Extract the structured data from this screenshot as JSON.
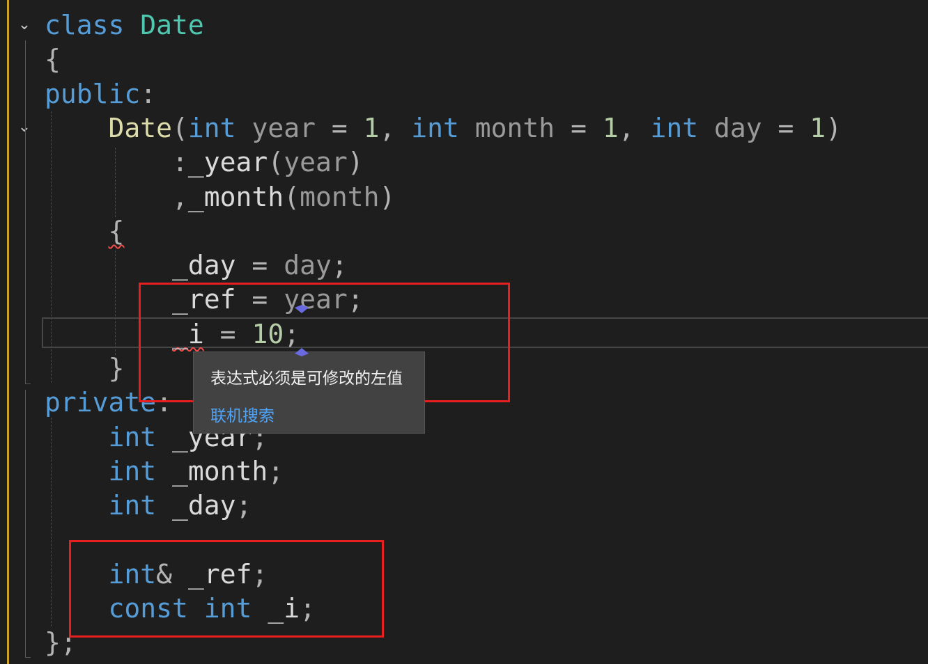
{
  "editor": {
    "lines": [
      {
        "id": "class-decl",
        "tokens": [
          {
            "t": "class",
            "c": "kw"
          },
          {
            "t": " ",
            "c": ""
          },
          {
            "t": "Date",
            "c": "type"
          }
        ]
      },
      {
        "id": "open-brace",
        "tokens": [
          {
            "t": "{",
            "c": "punc"
          }
        ]
      },
      {
        "id": "public-label",
        "tokens": [
          {
            "t": "public",
            "c": "kw"
          },
          {
            "t": ":",
            "c": "punc"
          }
        ]
      },
      {
        "id": "ctor-signature",
        "tokens": [
          {
            "t": "    ",
            "c": ""
          },
          {
            "t": "Date",
            "c": "fn"
          },
          {
            "t": "(",
            "c": "punc"
          },
          {
            "t": "int",
            "c": "kw"
          },
          {
            "t": " ",
            "c": ""
          },
          {
            "t": "year",
            "c": "param"
          },
          {
            "t": " = ",
            "c": "punc"
          },
          {
            "t": "1",
            "c": "num"
          },
          {
            "t": ", ",
            "c": "punc"
          },
          {
            "t": "int",
            "c": "kw"
          },
          {
            "t": " ",
            "c": ""
          },
          {
            "t": "month",
            "c": "param"
          },
          {
            "t": " = ",
            "c": "punc"
          },
          {
            "t": "1",
            "c": "num"
          },
          {
            "t": ", ",
            "c": "punc"
          },
          {
            "t": "int",
            "c": "kw"
          },
          {
            "t": " ",
            "c": ""
          },
          {
            "t": "day",
            "c": "param"
          },
          {
            "t": " = ",
            "c": "punc"
          },
          {
            "t": "1",
            "c": "num"
          },
          {
            "t": ")",
            "c": "punc"
          }
        ]
      },
      {
        "id": "init-year",
        "tokens": [
          {
            "t": "        ",
            "c": ""
          },
          {
            "t": ":",
            "c": "punc"
          },
          {
            "t": "_year",
            "c": "member"
          },
          {
            "t": "(",
            "c": "punc"
          },
          {
            "t": "year",
            "c": "param"
          },
          {
            "t": ")",
            "c": "punc"
          }
        ]
      },
      {
        "id": "init-month",
        "tokens": [
          {
            "t": "        ",
            "c": ""
          },
          {
            "t": ",",
            "c": "punc"
          },
          {
            "t": "_month",
            "c": "member"
          },
          {
            "t": "(",
            "c": "punc"
          },
          {
            "t": "month",
            "c": "param"
          },
          {
            "t": ")",
            "c": "punc"
          }
        ]
      },
      {
        "id": "ctor-open-brace",
        "tokens": [
          {
            "t": "    ",
            "c": ""
          },
          {
            "t": "{",
            "c": "punc squiggle"
          }
        ]
      },
      {
        "id": "assign-day",
        "tokens": [
          {
            "t": "        ",
            "c": ""
          },
          {
            "t": "_day",
            "c": "member"
          },
          {
            "t": " = ",
            "c": "punc"
          },
          {
            "t": "day",
            "c": "param"
          },
          {
            "t": ";",
            "c": "punc"
          }
        ]
      },
      {
        "id": "assign-ref",
        "tokens": [
          {
            "t": "        ",
            "c": ""
          },
          {
            "t": "_ref",
            "c": "member"
          },
          {
            "t": " = ",
            "c": "punc"
          },
          {
            "t": "year",
            "c": "param"
          },
          {
            "t": ";",
            "c": "punc"
          }
        ]
      },
      {
        "id": "assign-i",
        "tokens": [
          {
            "t": "        ",
            "c": ""
          },
          {
            "t": "_i",
            "c": "member squiggle"
          },
          {
            "t": " = ",
            "c": "punc"
          },
          {
            "t": "10",
            "c": "num"
          },
          {
            "t": ";",
            "c": "punc"
          }
        ]
      },
      {
        "id": "ctor-close-brace",
        "tokens": [
          {
            "t": "    ",
            "c": ""
          },
          {
            "t": "}",
            "c": "punc"
          }
        ]
      },
      {
        "id": "private-label",
        "tokens": [
          {
            "t": "private",
            "c": "kw"
          },
          {
            "t": ":",
            "c": "punc"
          }
        ]
      },
      {
        "id": "member-year",
        "tokens": [
          {
            "t": "    ",
            "c": ""
          },
          {
            "t": "int",
            "c": "kw"
          },
          {
            "t": " ",
            "c": ""
          },
          {
            "t": "_year",
            "c": "member"
          },
          {
            "t": ";",
            "c": "punc"
          }
        ]
      },
      {
        "id": "member-month",
        "tokens": [
          {
            "t": "    ",
            "c": ""
          },
          {
            "t": "int",
            "c": "kw"
          },
          {
            "t": " ",
            "c": ""
          },
          {
            "t": "_month",
            "c": "member"
          },
          {
            "t": ";",
            "c": "punc"
          }
        ]
      },
      {
        "id": "member-day",
        "tokens": [
          {
            "t": "    ",
            "c": ""
          },
          {
            "t": "int",
            "c": "kw"
          },
          {
            "t": " ",
            "c": ""
          },
          {
            "t": "_day",
            "c": "member"
          },
          {
            "t": ";",
            "c": "punc"
          }
        ]
      },
      {
        "id": "blank",
        "tokens": []
      },
      {
        "id": "member-ref",
        "tokens": [
          {
            "t": "    ",
            "c": ""
          },
          {
            "t": "int",
            "c": "kw"
          },
          {
            "t": "&",
            "c": "punc"
          },
          {
            "t": " ",
            "c": ""
          },
          {
            "t": "_ref",
            "c": "member"
          },
          {
            "t": ";",
            "c": "punc"
          }
        ]
      },
      {
        "id": "member-i",
        "tokens": [
          {
            "t": "    ",
            "c": ""
          },
          {
            "t": "const",
            "c": "kw"
          },
          {
            "t": " ",
            "c": ""
          },
          {
            "t": "int",
            "c": "kw"
          },
          {
            "t": " ",
            "c": ""
          },
          {
            "t": "_i",
            "c": "member"
          },
          {
            "t": ";",
            "c": "punc"
          }
        ]
      },
      {
        "id": "class-close",
        "tokens": [
          {
            "t": "}",
            "c": "punc"
          },
          {
            "t": ";",
            "c": "punc"
          }
        ]
      }
    ]
  },
  "tooltip": {
    "message": "表达式必须是可修改的左值",
    "link_label": "联机搜索"
  },
  "colors": {
    "background": "#1e1e1e",
    "keyword": "#569cd6",
    "type": "#4ec9b0",
    "function": "#dcdcaa",
    "number": "#b5cea8",
    "error_squiggle": "#f14c4c",
    "highlight_box": "#e81f1f",
    "link": "#4fa3f7"
  },
  "icons": {
    "fold": "chevron-down-icon",
    "quick_info_marker": "diamond-marker-icon"
  }
}
